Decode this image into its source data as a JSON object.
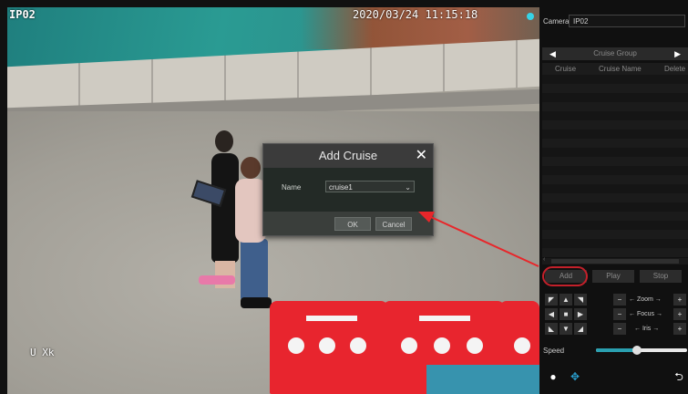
{
  "camera_view": {
    "osd_camera_name": "IP02",
    "osd_timestamp": "2020/03/24 11:15:18",
    "osd_bottom_text": "U Xk"
  },
  "dialog": {
    "title": "Add Cruise",
    "name_label": "Name",
    "name_value": "cruise1",
    "ok_label": "OK",
    "cancel_label": "Cancel"
  },
  "panel": {
    "camera_label": "Camera",
    "camera_value": "IP02",
    "group_label": "Cruise Group",
    "columns": [
      "Cruise",
      "Cruise Name",
      "Delete"
    ],
    "add_label": "Add",
    "play_label": "Play",
    "stop_label": "Stop",
    "zoom_label": "Zoom",
    "focus_label": "Focus",
    "iris_label": "Iris",
    "speed_label": "Speed",
    "speed_level": 0.45
  },
  "colors": {
    "highlight": "#c3202a",
    "arrow": "#e8262a"
  },
  "icons": [
    "close-icon",
    "chevron-down-icon",
    "arrow-left-icon",
    "arrow-right-icon",
    "record-icon",
    "ptz-move-icon",
    "back-icon"
  ]
}
